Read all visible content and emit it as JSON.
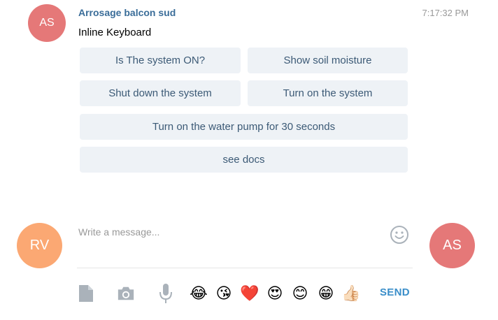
{
  "colors": {
    "accent": "#3a8ec9",
    "sender_name": "#3a6d99",
    "button_bg": "#eef2f6",
    "button_text": "#3c5a76",
    "avatar_bot": "#e57878",
    "avatar_user": "#fba873",
    "avatar_peer": "#e57878",
    "icon_gray": "#aab2ba"
  },
  "message": {
    "avatar_initials": "AS",
    "sender": "Arrosage balcon sud",
    "time": "7:17:32 PM",
    "text": "Inline Keyboard"
  },
  "keyboard": {
    "buttons": [
      "Is The system ON?",
      "Show soil moisture",
      "Shut down the system",
      "Turn on the system",
      "Turn on the water pump for 30 seconds",
      "see docs"
    ]
  },
  "composer": {
    "user_initials": "RV",
    "peer_initials": "AS",
    "placeholder": "Write a message...",
    "icons": [
      "file-icon",
      "camera-icon",
      "microphone-icon",
      "smile-icon"
    ],
    "emojis": [
      "😂",
      "😘",
      "❤️",
      "😍",
      "😊",
      "😁",
      "👍🏻"
    ],
    "send_label": "SEND"
  }
}
